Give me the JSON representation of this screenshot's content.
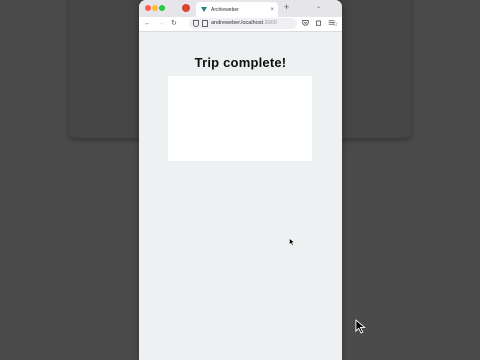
{
  "browser": {
    "tab_title": "Archieweber",
    "tab_close": "×",
    "new_tab": "+",
    "tab_list": "⌄",
    "nav": {
      "back": "←",
      "forward": "→",
      "reload": "↻"
    },
    "url_main": "andreweber.localhost",
    "url_rest": ":3000",
    "star": "☆",
    "icons": [
      "pocket-icon",
      "extensions-icon",
      "menu-icon"
    ]
  },
  "page": {
    "heading": "Trip complete!"
  },
  "colors": {
    "page_bg": "#eef1f1",
    "panel": "#ffffff",
    "desktop": "#4b4b4b"
  }
}
